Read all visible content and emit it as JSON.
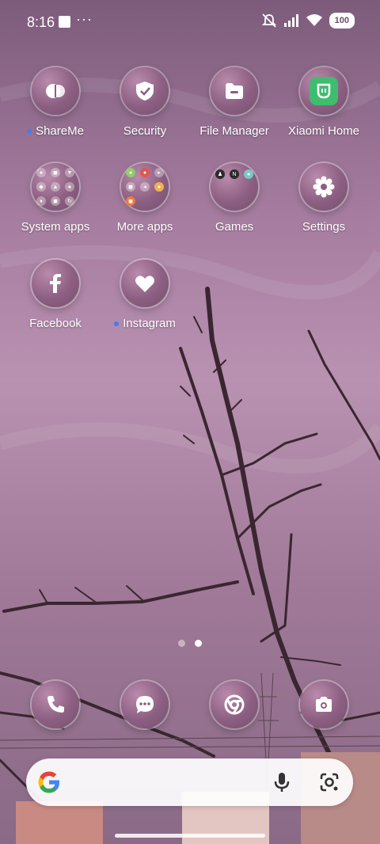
{
  "status_bar": {
    "time": "8:16",
    "more": "···",
    "battery": "100"
  },
  "apps": [
    {
      "label": "ShareMe",
      "icon": "shareme-icon",
      "new": true
    },
    {
      "label": "Security",
      "icon": "shield-icon",
      "new": false
    },
    {
      "label": "File Manager",
      "icon": "folder-icon",
      "new": false
    },
    {
      "label": "Xiaomi Home",
      "icon": "xiaomi-home-icon",
      "new": false
    },
    {
      "label": "System apps",
      "icon": "folder-grid-icon",
      "new": false
    },
    {
      "label": "More apps",
      "icon": "folder-grid-icon",
      "new": false
    },
    {
      "label": "Games",
      "icon": "folder-grid-icon",
      "new": false
    },
    {
      "label": "Settings",
      "icon": "gear-icon",
      "new": false
    },
    {
      "label": "Facebook",
      "icon": "facebook-icon",
      "new": false
    },
    {
      "label": "Instagram",
      "icon": "heart-icon",
      "new": true
    }
  ],
  "dock": [
    "phone-icon",
    "messages-icon",
    "chrome-icon",
    "camera-icon"
  ],
  "page_indicator": {
    "pages": 2,
    "active": 2
  },
  "colors": {
    "accent_dot": "#3d7dff",
    "xiaomi_green": "#3ebd6f"
  }
}
